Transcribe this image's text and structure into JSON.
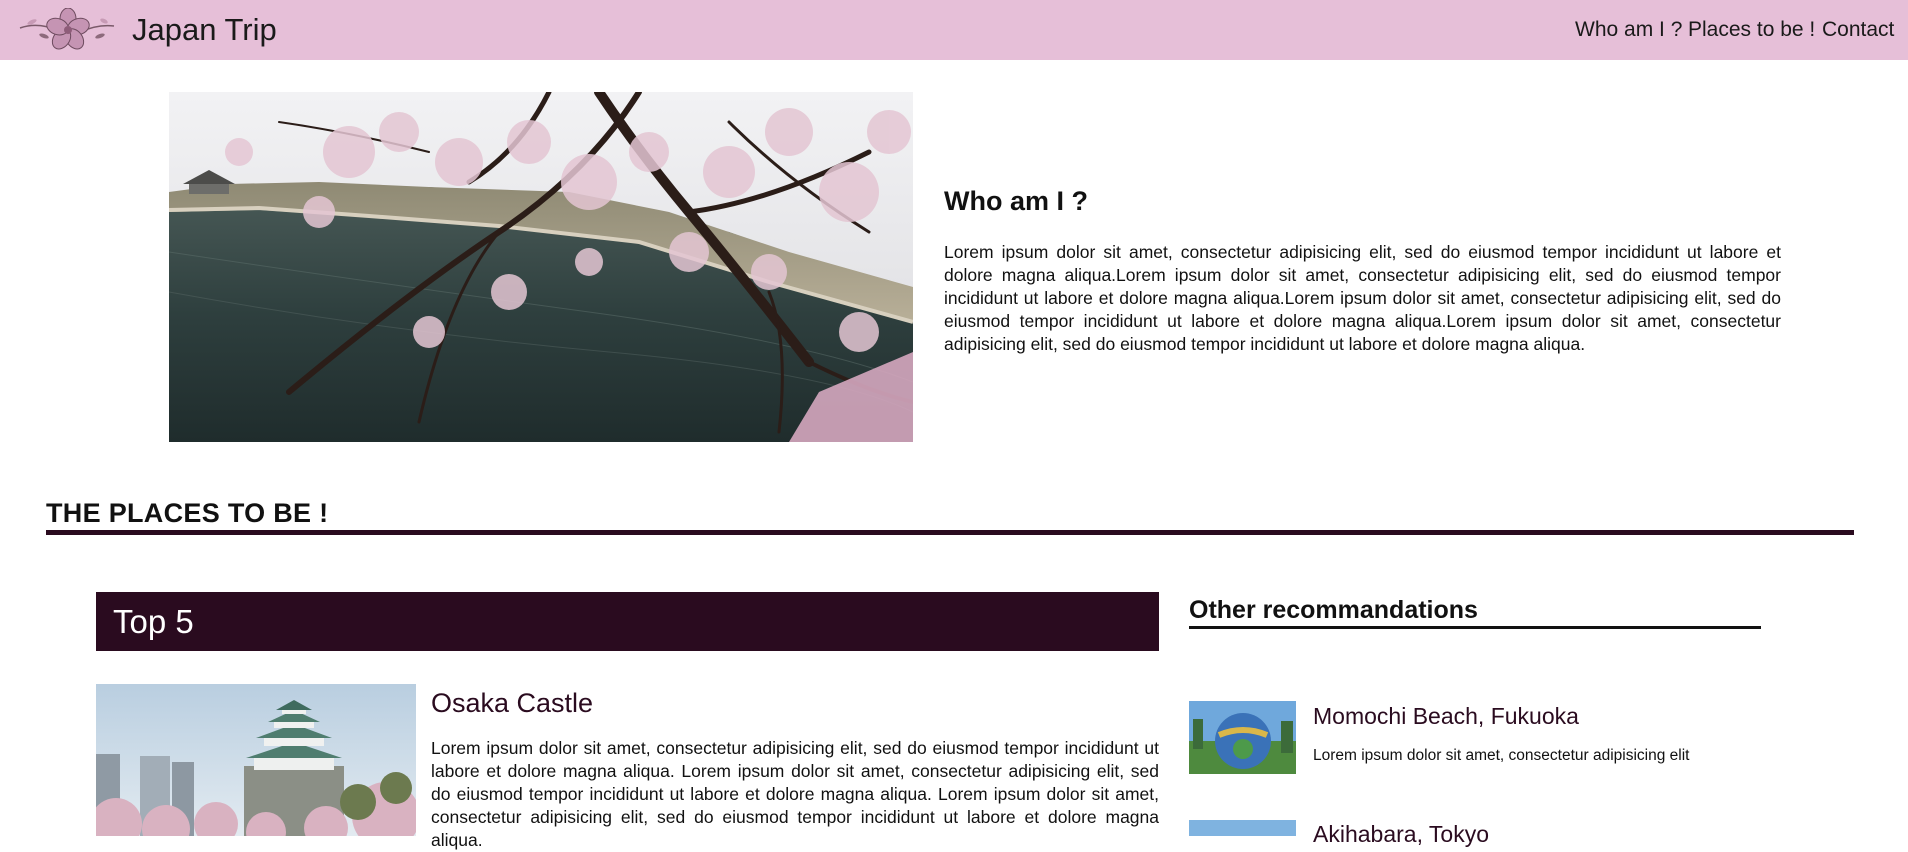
{
  "header": {
    "brand": "Japan Trip",
    "nav": [
      "Who am I ?",
      "Places to be !",
      "Contact"
    ],
    "background_color": "#e6bfd8"
  },
  "logo": {
    "icon": "sakura-flower-icon"
  },
  "about": {
    "heading": "Who am I ?",
    "text": "Lorem ipsum dolor sit amet, consectetur adipisicing elit, sed do eiusmod tempor incididunt ut labore et dolore magna aliqua.Lorem ipsum dolor sit amet, consectetur adipisicing elit, sed do eiusmod tempor incididunt ut labore et dolore magna aliqua.Lorem ipsum dolor sit amet, consectetur adipisicing elit, sed do eiusmod tempor incididunt ut labore et dolore magna aliqua.Lorem ipsum dolor sit amet, consectetur adipisicing elit, sed do eiusmod tempor incididunt ut labore et dolore magna aliqua."
  },
  "places": {
    "heading": "THE PLACES TO BE !",
    "accent_color": "#2a0b1f"
  },
  "top5": {
    "heading": "Top 5",
    "items": [
      {
        "title": "Osaka Castle",
        "text": "Lorem ipsum dolor sit amet, consectetur adipisicing elit, sed do eiusmod tempor incididunt ut labore et dolore magna aliqua. Lorem ipsum dolor sit amet, consectetur adipisicing elit, sed do eiusmod tempor incididunt ut labore et dolore magna aliqua. Lorem ipsum dolor sit amet, consectetur adipisicing elit, sed do eiusmod tempor incididunt ut labore et dolore magna aliqua."
      }
    ]
  },
  "other": {
    "heading": "Other recommandations",
    "items": [
      {
        "title": "Momochi Beach, Fukuoka",
        "text": "Lorem ipsum dolor sit amet, consectetur adipisicing elit"
      },
      {
        "title": "Akihabara, Tokyo",
        "text": ""
      }
    ]
  }
}
